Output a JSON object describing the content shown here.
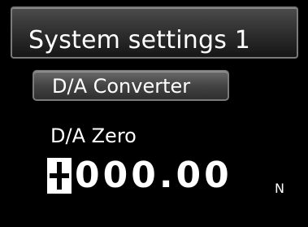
{
  "header": {
    "title": "System settings 1"
  },
  "menu": {
    "button_label": "D/A Converter"
  },
  "setting": {
    "label": "D/A Zero",
    "value_digits": "000.00",
    "unit": "N",
    "sign_cursor": "+"
  }
}
